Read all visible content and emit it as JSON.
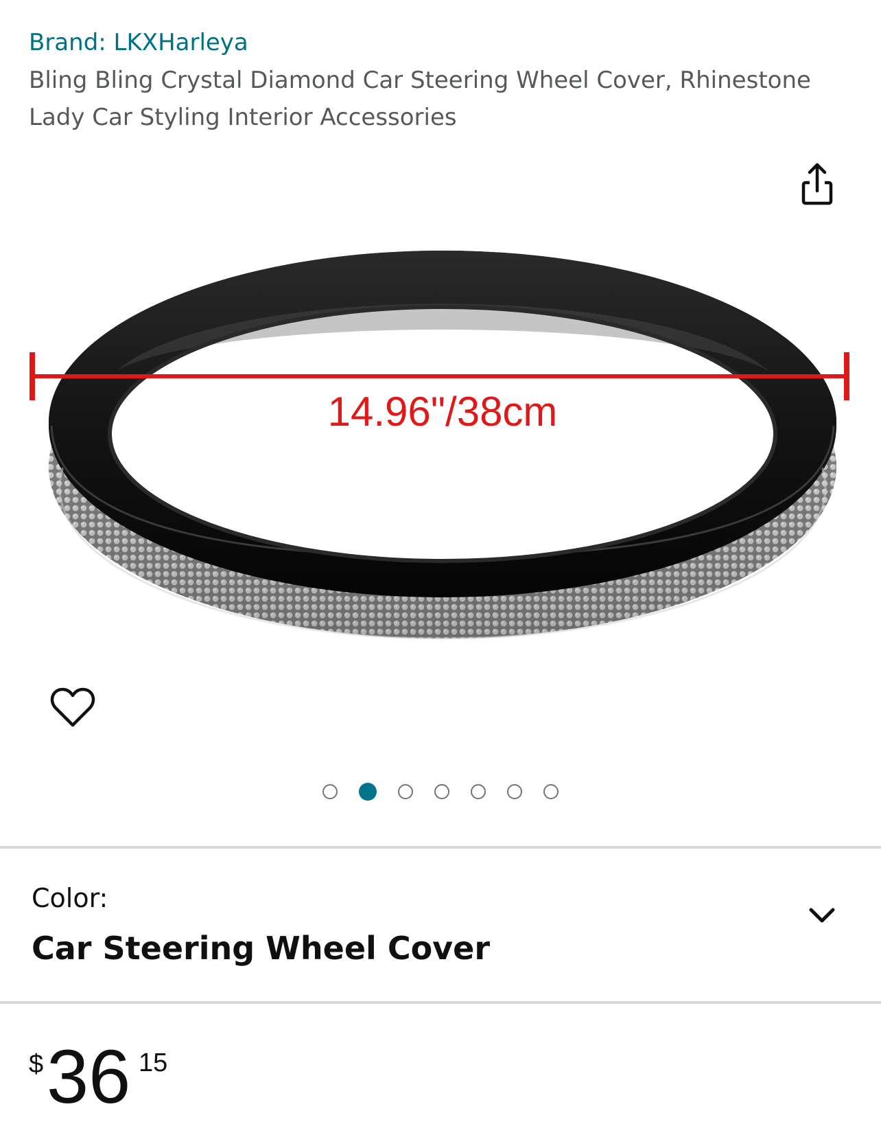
{
  "product": {
    "brand": "Brand: LKXHarleya",
    "title": "Bling Bling Crystal Diamond Car Steering Wheel Cover, Rhinestone Lady Car Styling Interior Accessories",
    "image_measurement": "14.96\"/38cm"
  },
  "icons": {
    "share": "share-icon",
    "wishlist": "heart-icon",
    "dropdown": "chevron-down-icon"
  },
  "carousel": {
    "total": 7,
    "active_index": 1
  },
  "variation": {
    "label": "Color:",
    "value": "Car Steering Wheel Cover"
  },
  "price": {
    "symbol": "$",
    "whole": "36",
    "fraction": "15"
  },
  "colors": {
    "brand_link": "#007185",
    "title_gray": "#565959",
    "active_dot": "#00748a",
    "measure_red": "#e01818"
  }
}
